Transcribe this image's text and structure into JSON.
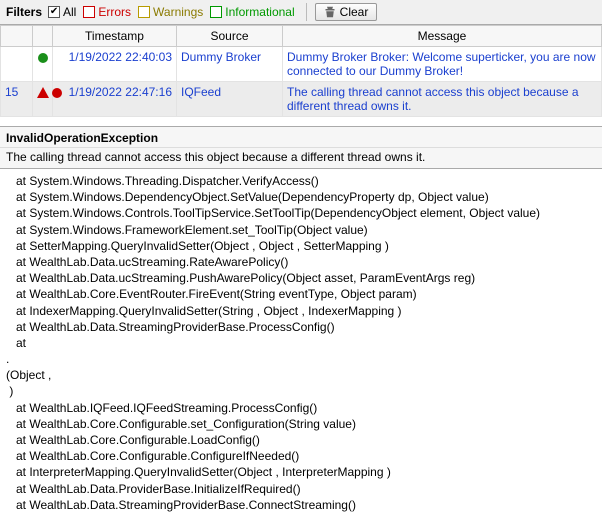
{
  "toolbar": {
    "label": "Filters",
    "all": "All",
    "errors": "Errors",
    "warnings": "Warnings",
    "info": "Informational",
    "clear": "Clear"
  },
  "columns": {
    "ts": "Timestamp",
    "src": "Source",
    "msg": "Message"
  },
  "rows": [
    {
      "id": "",
      "kind": "ok",
      "ts": "1/19/2022 22:40:03",
      "src": "Dummy Broker",
      "msg": "Dummy Broker Broker: Welcome superticker, you are now connected to our Dummy Broker!"
    },
    {
      "id": "15",
      "kind": "err",
      "ts": "1/19/2022 22:47:16",
      "src": "IQFeed",
      "msg": "The calling thread cannot access this object because a different thread owns it."
    }
  ],
  "detail": {
    "title": "InvalidOperationException",
    "summary": "The calling thread cannot access this object because a different thread owns it.",
    "trace": "   at System.Windows.Threading.Dispatcher.VerifyAccess()\n   at System.Windows.DependencyObject.SetValue(DependencyProperty dp, Object value)\n   at System.Windows.Controls.ToolTipService.SetToolTip(DependencyObject element, Object value)\n   at System.Windows.FrameworkElement.set_ToolTip(Object value)\n   at SetterMapping.QueryInvalidSetter(Object , Object , SetterMapping )\n   at WealthLab.Data.ucStreaming.RateAwarePolicy()\n   at WealthLab.Data.ucStreaming.PushAwarePolicy(Object asset, ParamEventArgs reg)\n   at WealthLab.Core.EventRouter.FireEvent(String eventType, Object param)\n   at IndexerMapping.QueryInvalidSetter(String , Object , IndexerMapping )\n   at WealthLab.Data.StreamingProviderBase.ProcessConfig()\n   at \n.\n(Object , \n )\n   at WealthLab.IQFeed.IQFeedStreaming.ProcessConfig()\n   at WealthLab.Core.Configurable.set_Configuration(String value)\n   at WealthLab.Core.Configurable.LoadConfig()\n   at WealthLab.Core.Configurable.ConfigureIfNeeded()\n   at InterpreterMapping.QueryInvalidSetter(Object , InterpreterMapping )\n   at WealthLab.Data.ProviderBase.InitializeIfRequired()\n   at WealthLab.Data.StreamingProviderBase.ConnectStreaming()"
  }
}
